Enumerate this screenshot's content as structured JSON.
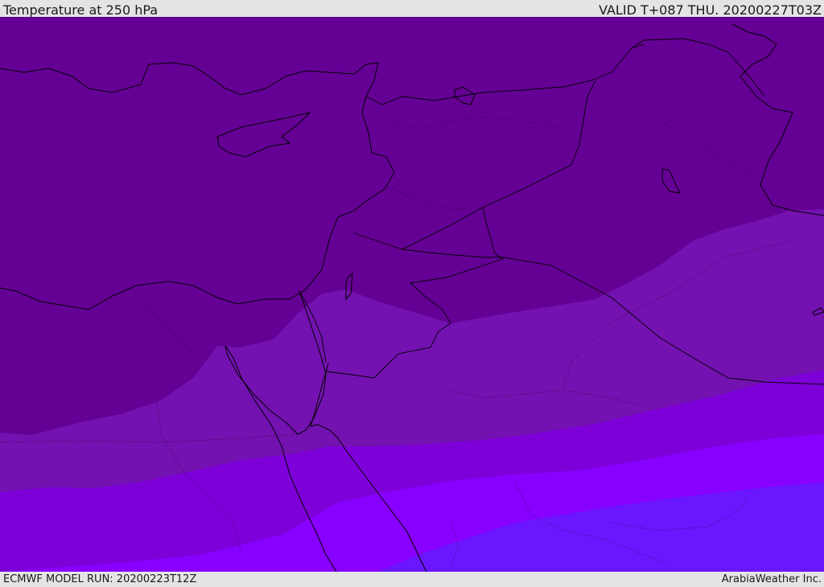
{
  "header": {
    "title": "Temperature at 250 hPa",
    "valid_time": "VALID T+087 THU. 20200227T03Z"
  },
  "footer": {
    "model_run": "ECMWF MODEL RUN: 20200223T12Z",
    "credit": "ArabiaWeather Inc."
  },
  "map": {
    "parameter": "Temperature",
    "level_hpa": 250,
    "region": "Eastern Mediterranean / Levant / Red Sea",
    "legend_shown": false,
    "temperature_bands_colors": [
      "#650095",
      "#7312b0",
      "#7d00d9",
      "#8800ff",
      "#6a17ff"
    ],
    "coastline_color": "#000000"
  }
}
